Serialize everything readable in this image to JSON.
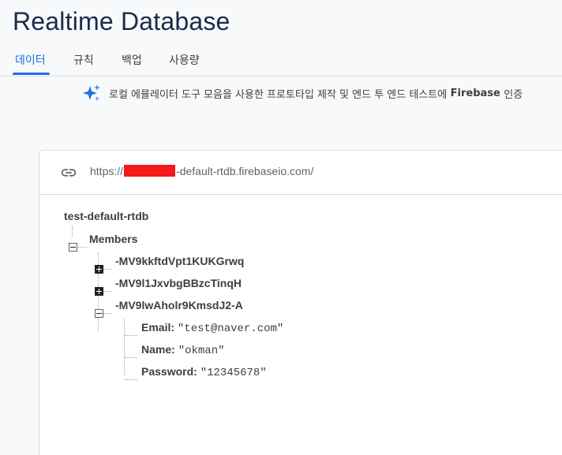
{
  "header": {
    "title": "Realtime Database"
  },
  "tabs": [
    {
      "label": "데이터",
      "active": true
    },
    {
      "label": "규칙",
      "active": false
    },
    {
      "label": "백업",
      "active": false
    },
    {
      "label": "사용량",
      "active": false
    }
  ],
  "banner": {
    "icon": "sparkle-icon",
    "text": "로컬 에뮬레이터 도구 모음을 사용한 프로토타입 제작 및 엔드 투 엔드 테스트에",
    "brand": "Firebase",
    "tail": "인증"
  },
  "database": {
    "url_prefix": "https://",
    "url_redacted": "—————",
    "url_suffix": "-default-rtdb.firebaseio.com/",
    "root": "test-default-rtdb",
    "members_key": "Members",
    "entries": [
      {
        "key": "-MV9kkftdVpt1KUKGrwq",
        "expanded": false
      },
      {
        "key": "-MV9l1JxvbgBBzcTinqH",
        "expanded": false
      },
      {
        "key": "-MV9lwAholr9KmsdJ2-A",
        "expanded": true
      }
    ],
    "fields": [
      {
        "name": "Email:",
        "value": "\"test@naver.com\""
      },
      {
        "name": "Name:",
        "value": "\"okman\""
      },
      {
        "name": "Password:",
        "value": "\"12345678\""
      }
    ]
  },
  "colors": {
    "accent": "#1a73e8",
    "redaction": "#f21a1a",
    "title": "#1a2b4a"
  }
}
